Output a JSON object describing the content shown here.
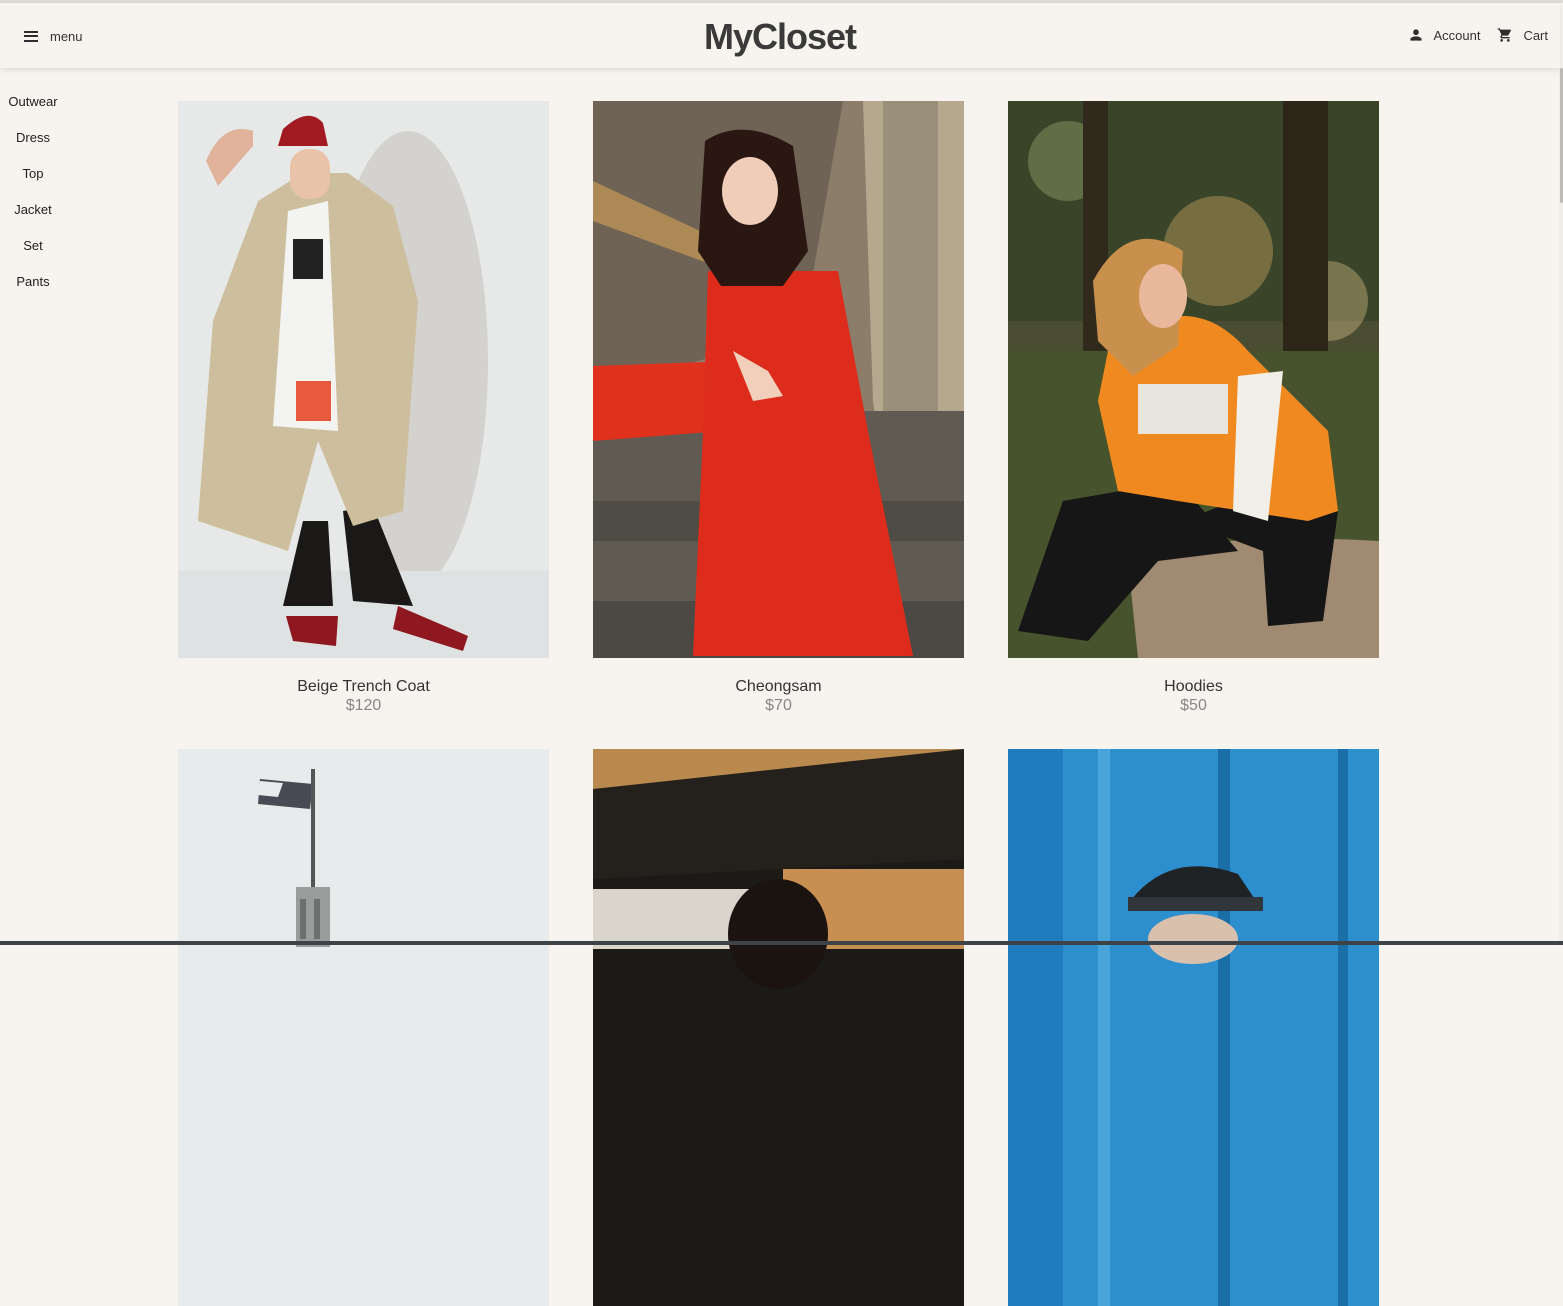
{
  "header": {
    "menu_label": "menu",
    "logo": "MyCloset",
    "account_label": "Account",
    "cart_label": "Cart"
  },
  "sidebar": {
    "categories": [
      "Outwear",
      "Dress",
      "Top",
      "Jacket",
      "Set",
      "Pants"
    ]
  },
  "products": [
    {
      "name": "Beige Trench Coat",
      "price": "$120"
    },
    {
      "name": "Cheongsam",
      "price": "$70"
    },
    {
      "name": "Hoodies",
      "price": "$50"
    }
  ],
  "colors": {
    "background": "#f7f3ee",
    "text": "#333333",
    "price": "#888888"
  },
  "icons": [
    "hamburger-menu-icon",
    "person-icon",
    "cart-icon"
  ]
}
